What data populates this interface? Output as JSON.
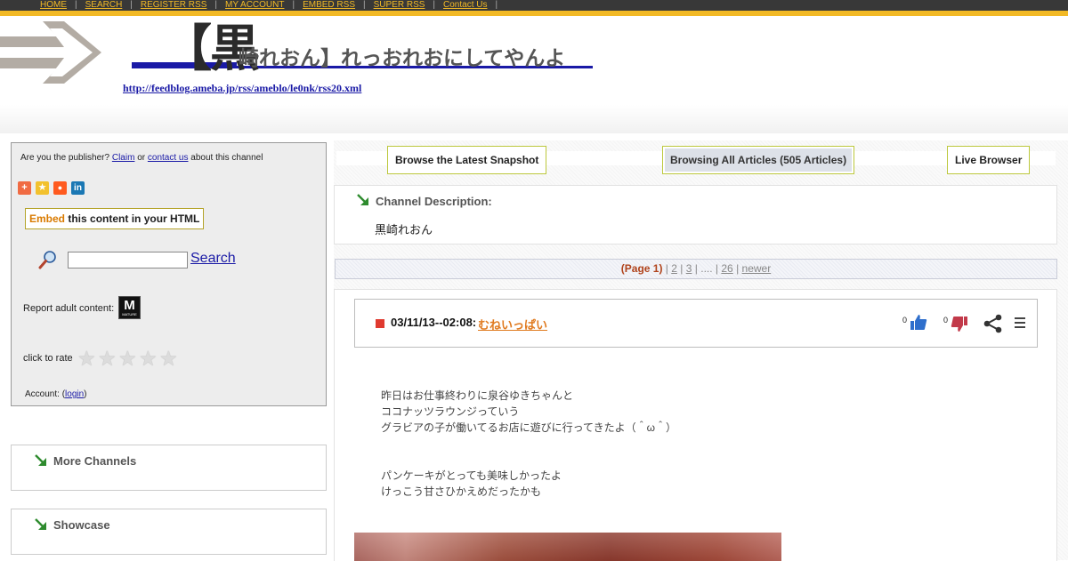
{
  "nav": {
    "items": [
      "HOME",
      "SEARCH",
      "REGISTER RSS",
      "MY ACCOUNT",
      "EMBED RSS",
      "SUPER RSS",
      "Contact Us"
    ]
  },
  "header": {
    "title_big": "【黒",
    "title_rest": "崎れおん】れっおれおにしてやんよ",
    "feed_url": "http://feedblog.ameba.jp/rss/ameblo/le0nk/rss20.xml"
  },
  "sidebar": {
    "claim_prefix": "Are you the publisher?",
    "claim_link": "Claim",
    "claim_or": "or",
    "contact_link": "contact us",
    "claim_suffix": "about this channel",
    "share_icons": [
      "addthis-icon",
      "favorite-star-icon",
      "reddit-icon",
      "linkedin-icon"
    ],
    "embed_highlight": "Embed",
    "embed_rest": "this content in your HTML",
    "search_placeholder": "",
    "search_label": "Search",
    "adult_label": "Report adult content:",
    "adult_badge": "M",
    "adult_badge_sub": "MATURE",
    "rate_label": "click to rate",
    "rating_stars": 5,
    "account_prefix": "Account: (",
    "account_link": "login",
    "account_suffix": ")",
    "more_channels": "More Channels",
    "showcase": "Showcase"
  },
  "tabs": {
    "latest": "Browse the Latest Snapshot",
    "all": "Browsing All Articles (505 Articles)",
    "live": "Live Browser"
  },
  "description": {
    "label": "Channel Description:",
    "value": "黒崎れおん"
  },
  "pager": {
    "current": "(Page 1)",
    "p2": "2",
    "p3": "3",
    "dots": "....",
    "last": "26",
    "newer": "newer"
  },
  "article": {
    "date": "03/11/13--02:08:",
    "title": "むねいっぱい",
    "likes": "0",
    "dislikes": "0",
    "paragraph1": [
      "昨日はお仕事終わりに泉谷ゆきちゃんと",
      "ココナッツラウンジっていう",
      "グラビアの子が働いてるお店に遊びに行ってきたよ（＾ω＾）"
    ],
    "paragraph2": [
      "パンケーキがとっても美味しかったよ",
      "けっこう甘さひかえめだったかも"
    ]
  },
  "colors": {
    "nav_bg": "#383838",
    "nav_accent": "#f2b925",
    "link": "#1a1aa6",
    "title_orange": "#e07a1f",
    "page_current": "#b0431b",
    "arrow_green": "#2e8b2e"
  }
}
